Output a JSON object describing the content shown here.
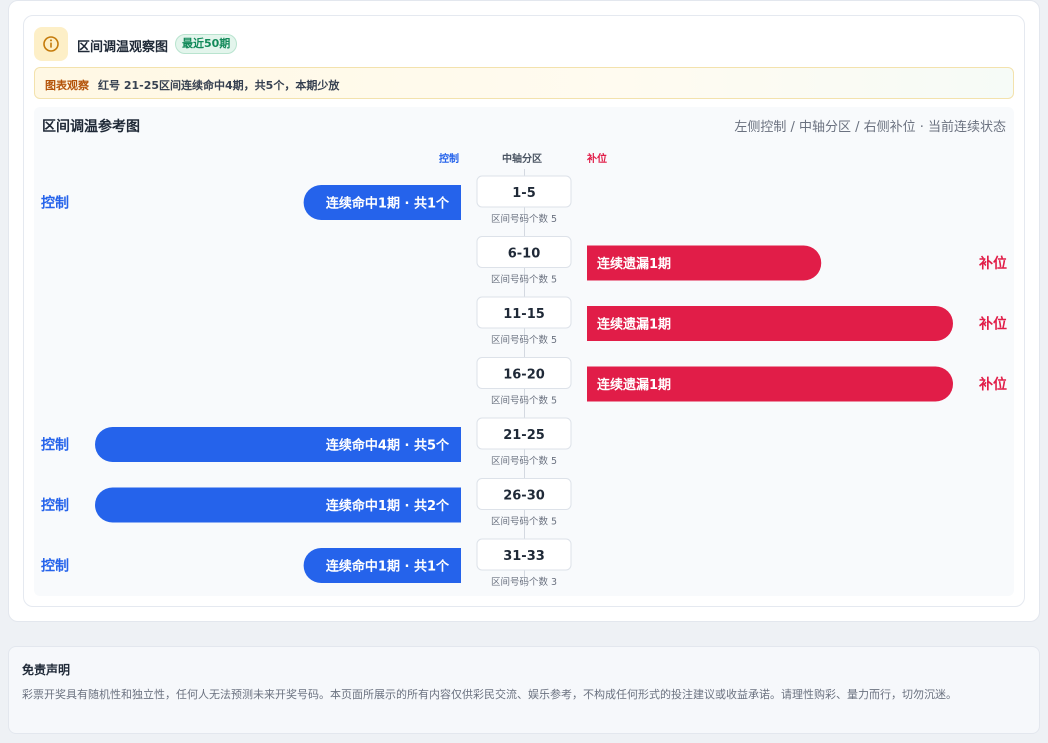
{
  "header": {
    "title": "区间调温观察图",
    "period_badge": "最近50期",
    "icon": "info-icon"
  },
  "observation": {
    "label": "图表观察",
    "text": "红号 21-25区间连续命中4期，共5个，本期少放"
  },
  "chart_data": {
    "type": "bar",
    "title": "区间调温参考图",
    "subtitle": "左侧控制 / 中轴分区 / 右侧补位 · 当前连续状态",
    "column_headers": {
      "left": "控制",
      "center": "中轴分区",
      "right": "补位"
    },
    "colors": {
      "control": "#2563eb",
      "fill": "#e11d48"
    },
    "rows": [
      {
        "zone": "1-5",
        "zone_note": "区间号码个数 5",
        "side": "control",
        "side_label": "控制",
        "bar_label": "连续命中1期 · 共1个",
        "streak": 1,
        "count": 1,
        "level": 0.43
      },
      {
        "zone": "6-10",
        "zone_note": "区间号码个数 5",
        "side": "fill",
        "side_label": "补位",
        "bar_label": "连续遗漏1期",
        "streak": 1,
        "level": 0.64
      },
      {
        "zone": "11-15",
        "zone_note": "区间号码个数 5",
        "side": "fill",
        "side_label": "补位",
        "bar_label": "连续遗漏1期",
        "streak": 1,
        "level": 1.0
      },
      {
        "zone": "16-20",
        "zone_note": "区间号码个数 5",
        "side": "fill",
        "side_label": "补位",
        "bar_label": "连续遗漏1期",
        "streak": 1,
        "level": 1.0
      },
      {
        "zone": "21-25",
        "zone_note": "区间号码个数 5",
        "side": "control",
        "side_label": "控制",
        "bar_label": "连续命中4期 · 共5个",
        "streak": 4,
        "count": 5,
        "level": 1.0
      },
      {
        "zone": "26-30",
        "zone_note": "区间号码个数 5",
        "side": "control",
        "side_label": "控制",
        "bar_label": "连续命中1期 · 共2个",
        "streak": 1,
        "count": 2,
        "level": 1.0
      },
      {
        "zone": "31-33",
        "zone_note": "区间号码个数 3",
        "side": "control",
        "side_label": "控制",
        "bar_label": "连续命中1期 · 共1个",
        "streak": 1,
        "count": 1,
        "level": 0.43
      }
    ]
  },
  "disclaimer": {
    "title": "免责声明",
    "text": "彩票开奖具有随机性和独立性，任何人无法预测未来开奖号码。本页面所展示的所有内容仅供彩民交流、娱乐参考，不构成任何形式的投注建议或收益承诺。请理性购彩、量力而行，切勿沉迷。"
  }
}
